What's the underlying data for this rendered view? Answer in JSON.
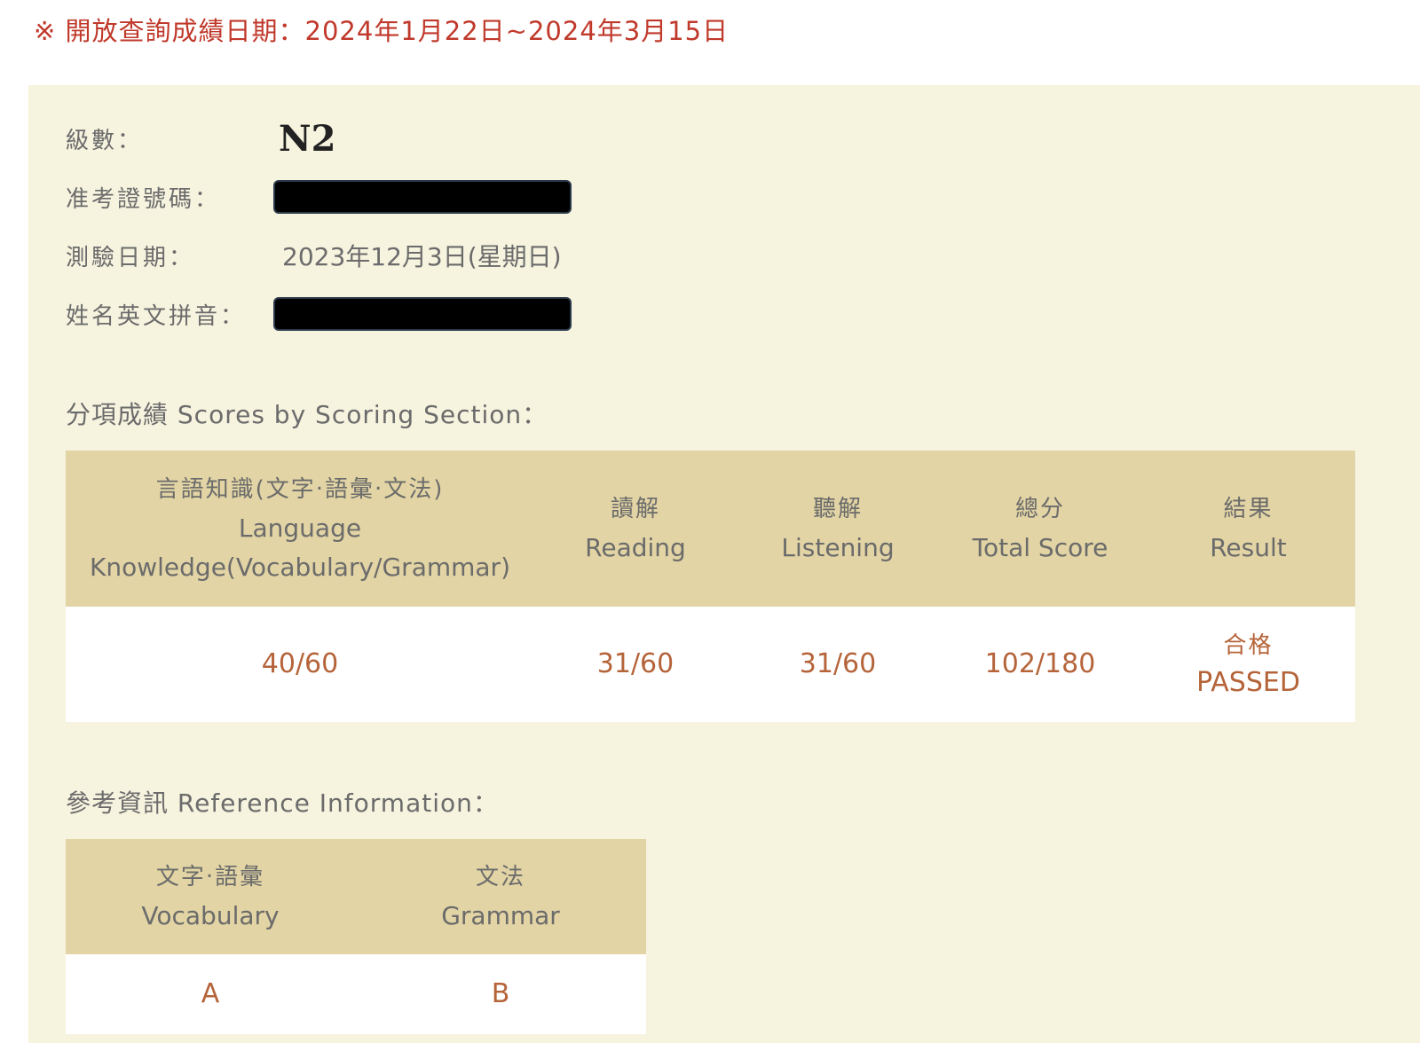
{
  "notice": "※ 開放查詢成績日期：2024年1月22日~2024年3月15日",
  "info": {
    "level_label": "級數：",
    "level_value": "N2",
    "exam_id_label": "准考證號碼：",
    "test_date_label": "測驗日期：",
    "test_date_value": "2023年12月3日(星期日)",
    "name_label": "姓名英文拼音："
  },
  "scores": {
    "heading": "分項成績 Scores by Scoring Section：",
    "headers": [
      {
        "zh": "言語知識(文字‧語彙‧文法)",
        "en": "Language Knowledge(Vocabulary/Grammar)"
      },
      {
        "zh": "讀解",
        "en": "Reading"
      },
      {
        "zh": "聽解",
        "en": "Listening"
      },
      {
        "zh": "總分",
        "en": "Total Score"
      },
      {
        "zh": "結果",
        "en": "Result"
      }
    ],
    "values": {
      "language_knowledge": "40/60",
      "reading": "31/60",
      "listening": "31/60",
      "total": "102/180",
      "result_zh": "合格",
      "result_en": "PASSED"
    }
  },
  "reference": {
    "heading": "參考資訊 Reference Information：",
    "headers": [
      {
        "zh": "文字‧語彙",
        "en": "Vocabulary"
      },
      {
        "zh": "文法",
        "en": "Grammar"
      }
    ],
    "values": {
      "vocabulary": "A",
      "grammar": "B"
    }
  },
  "colors": {
    "notice_red": "#c0392b",
    "panel_bg": "#f6f3df",
    "header_bg": "#e2d4a4",
    "score_text": "#b5643a"
  }
}
